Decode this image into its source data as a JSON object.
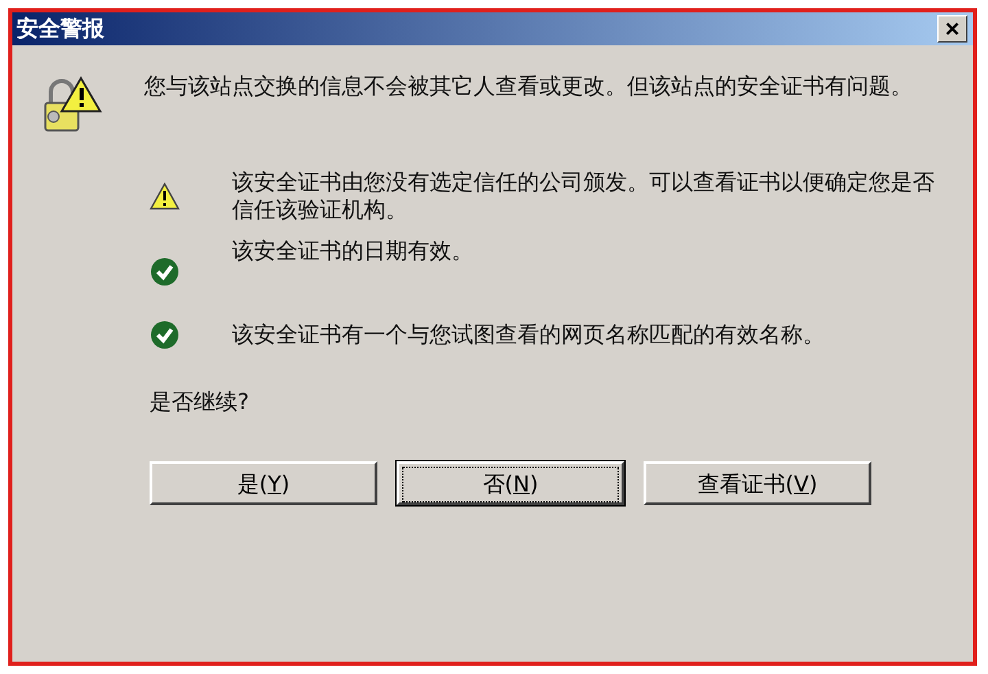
{
  "window": {
    "title": "安全警报",
    "close": "×"
  },
  "message": "您与该站点交换的信息不会被其它人查看或更改。但该站点的安全证书有问题。",
  "items": [
    {
      "kind": "warning",
      "text": "该安全证书由您没有选定信任的公司颁发。可以查看证书以便确定您是否信任该验证机构。"
    },
    {
      "kind": "ok",
      "text": "该安全证书的日期有效。"
    },
    {
      "kind": "ok",
      "text": "该安全证书有一个与您试图查看的网页名称匹配的有效名称。"
    }
  ],
  "question": "是否继续?",
  "buttons": [
    {
      "prefix": "是(",
      "key": "Y",
      "suffix": ")",
      "default": false
    },
    {
      "prefix": "否(",
      "key": "N",
      "suffix": ")",
      "default": true
    },
    {
      "prefix": "查看证书(",
      "key": "V",
      "suffix": ")",
      "default": false
    }
  ]
}
